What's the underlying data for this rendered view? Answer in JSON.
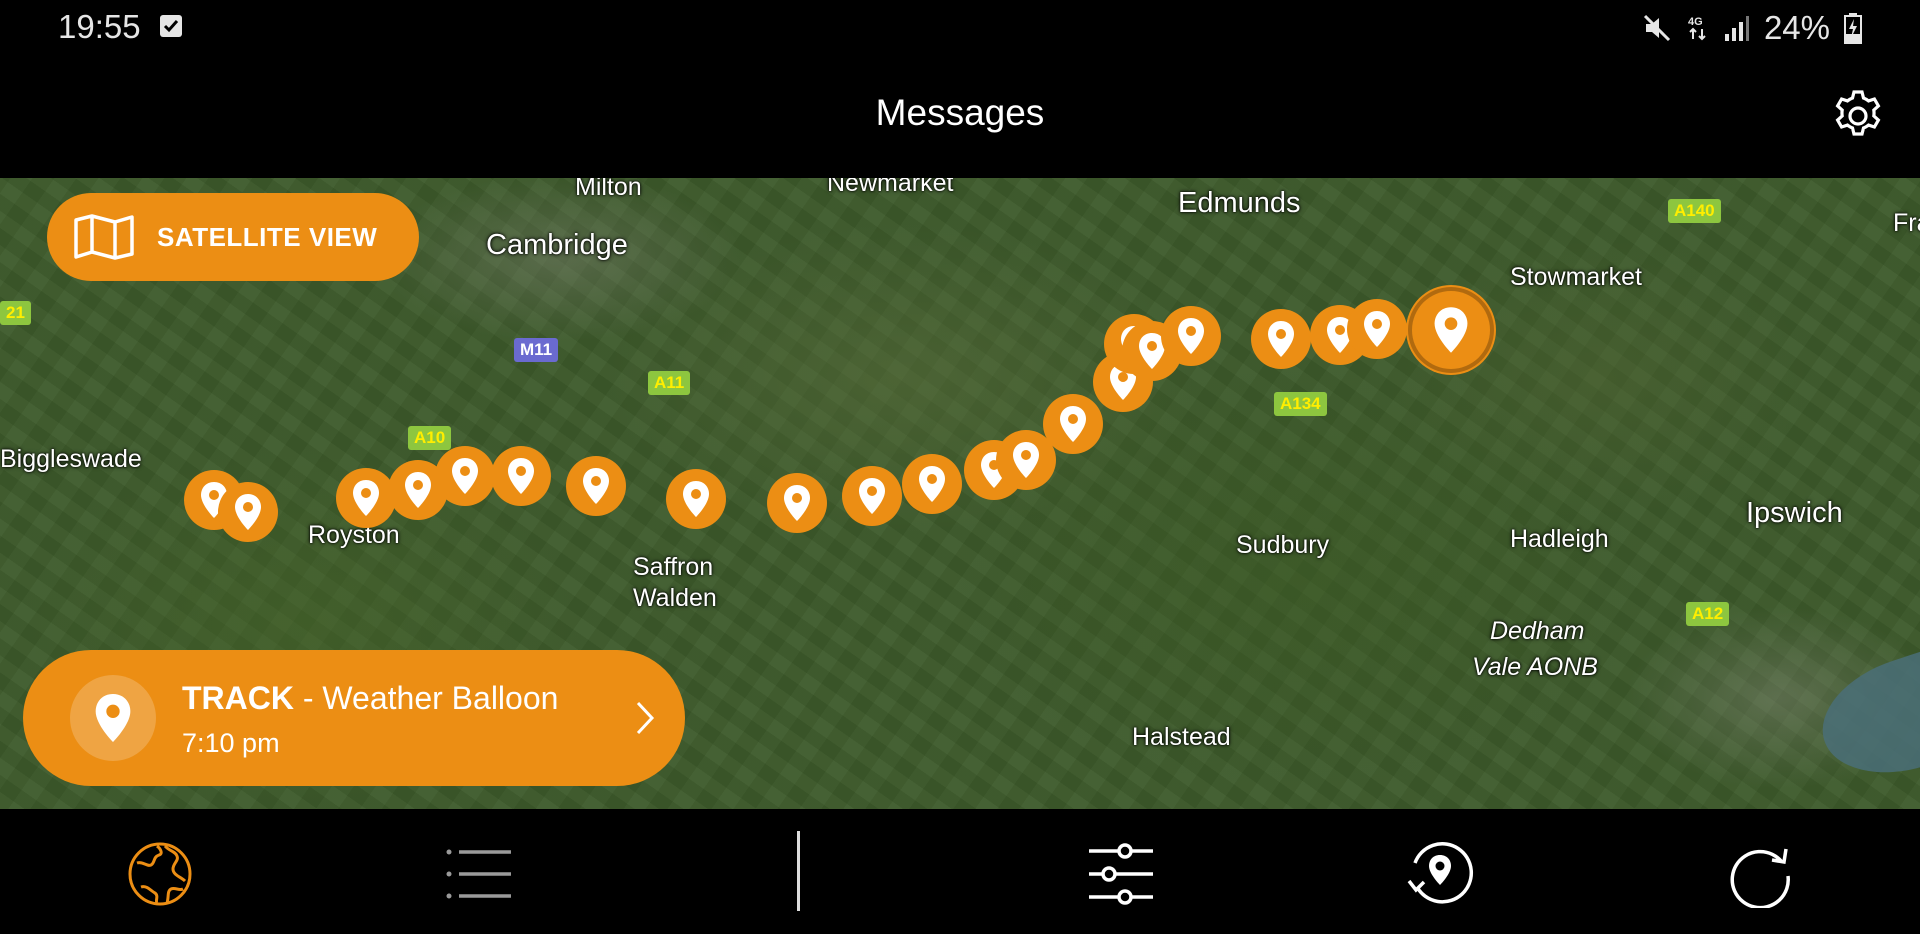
{
  "status_bar": {
    "time": "19:55",
    "battery": "24%"
  },
  "header": {
    "title": "Messages"
  },
  "map": {
    "places": [
      {
        "name": "Milton"
      },
      {
        "name": "Newmarket"
      },
      {
        "name": "Edmunds"
      },
      {
        "name": "Cambridge"
      },
      {
        "name": "Stowmarket"
      },
      {
        "name": "Biggleswade"
      },
      {
        "name": "Royston"
      },
      {
        "name": "Saffron"
      },
      {
        "name": "Walden"
      },
      {
        "name": "Sudbury"
      },
      {
        "name": "Hadleigh"
      },
      {
        "name": "Ipswich"
      },
      {
        "name": "Dedham"
      },
      {
        "name": "Vale AONB"
      },
      {
        "name": "Halstead"
      },
      {
        "name": "Fra"
      }
    ],
    "roads": [
      {
        "label": "A140"
      },
      {
        "label": "M11"
      },
      {
        "label": "A11"
      },
      {
        "label": "A10"
      },
      {
        "label": "A134"
      },
      {
        "label": "A12"
      },
      {
        "label": "21"
      }
    ],
    "accent_color": "#ec8e14",
    "stop_color": "#e41b23"
  },
  "satellite_button": {
    "label": "SATELLITE VIEW",
    "icon": "map-icon"
  },
  "track_card": {
    "title": "TRACK",
    "separator": " - ",
    "subtitle": "Weather Balloon",
    "time": "7:10 pm",
    "icon": "location-pin-icon"
  },
  "bottom_nav": [
    {
      "icon": "globe-icon",
      "active": true
    },
    {
      "icon": "list-icon",
      "active": false
    },
    {
      "icon": "filters-icon",
      "active": false
    },
    {
      "icon": "location-history-icon",
      "active": false
    },
    {
      "icon": "refresh-icon",
      "active": false
    }
  ]
}
